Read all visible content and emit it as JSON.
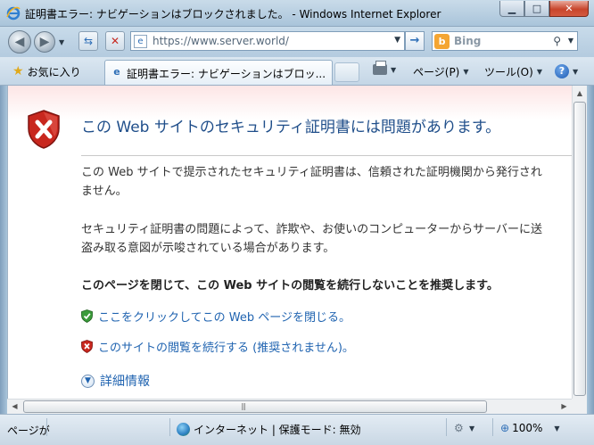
{
  "window": {
    "title": "証明書エラー: ナビゲーションはブロックされました。 - Windows Internet Explorer",
    "minimize": "▁",
    "maximize": "□",
    "close": "✕"
  },
  "address_bar": {
    "url": "https://www.server.world/",
    "search_placeholder": "Bing"
  },
  "toolbar": {
    "favorites_label": "お気に入り",
    "tab_label": "証明書エラー: ナビゲーションはブロッ...",
    "page_label": "ページ(P)",
    "tools_label": "ツール(O)"
  },
  "content": {
    "title": "この Web サイトのセキュリティ証明書には問題があります。",
    "para1_line1": "この Web サイトで提示されたセキュリティ証明書は、信頼された証明機関から発行され",
    "para1_line2": "ません。",
    "para2_line1": "セキュリティ証明書の問題によって、詐欺や、お使いのコンピューターからサーバーに送",
    "para2_line2": "盗み取る意図が示唆されている場合があります。",
    "recommendation": "このページを閉じて、この Web サイトの閲覧を続行しないことを推奨します。",
    "close_link": "ここをクリックしてこの Web ページを閉じる。",
    "continue_link": "このサイトの閲覧を続行する (推奨されません)。",
    "more_info": "詳細情報"
  },
  "statusbar": {
    "status_text": "ページが",
    "zone": "インターネット | 保護モード: 無効",
    "zoom": "100%"
  },
  "icons": {
    "app": "ie-logo-icon",
    "error_shield": "red-shield-x-icon",
    "safe_shield": "green-shield-check-icon",
    "unsafe_shield": "red-shield-x-icon"
  },
  "colors": {
    "title_text": "#1f4e8a",
    "link": "#1f63b0",
    "error_red": "#c62b22",
    "safe_green": "#3a9b3a"
  }
}
